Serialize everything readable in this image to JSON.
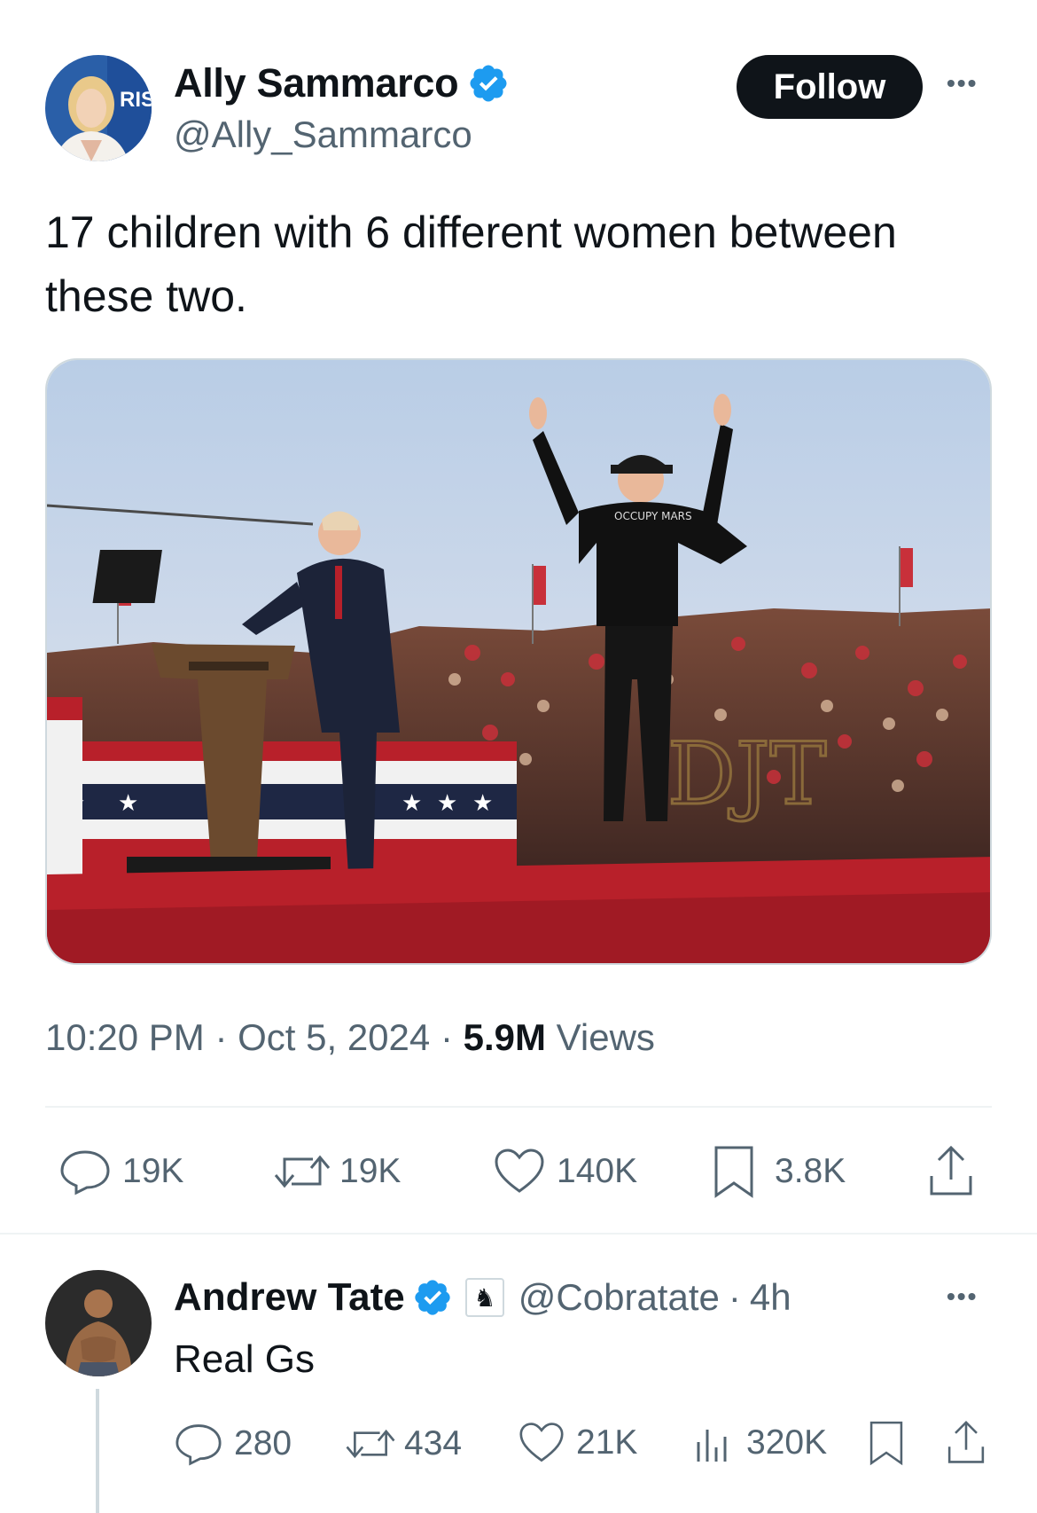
{
  "tweet": {
    "author_name": "Ally Sammarco",
    "author_handle": "@Ally_Sammarco",
    "follow_label": "Follow",
    "more_label": "•••",
    "text": "17 children with 6 different women between these two.",
    "time": "10:20 PM",
    "date": "Oct 5, 2024",
    "views_count": "5.9M",
    "views_label": "Views",
    "separator": "·",
    "avatar_sign_text": "RIS",
    "stats": {
      "replies": "19K",
      "reposts": "19K",
      "likes": "140K",
      "bookmarks": "3.8K"
    }
  },
  "reply": {
    "author_name": "Andrew Tate",
    "author_handle": "@Cobratate",
    "age": "4h",
    "separator": "·",
    "more_label": "•••",
    "text": "Real Gs",
    "stats": {
      "replies": "280",
      "reposts": "434",
      "likes": "21K",
      "views": "320K"
    }
  },
  "media": {
    "shirt_text": "OCCUPY MARS",
    "sign_text": "DJT"
  },
  "colors": {
    "verified_blue": "#1d9bf0",
    "text_primary": "#0f1419",
    "text_secondary": "#536471",
    "follow_bg": "#0f1419",
    "stage_red": "#b8202a"
  },
  "icons": {
    "reply": "reply-icon",
    "repost": "repost-icon",
    "like": "heart-icon",
    "bookmark": "bookmark-icon",
    "share": "share-icon",
    "views": "views-icon",
    "verified": "verified-badge-icon"
  }
}
